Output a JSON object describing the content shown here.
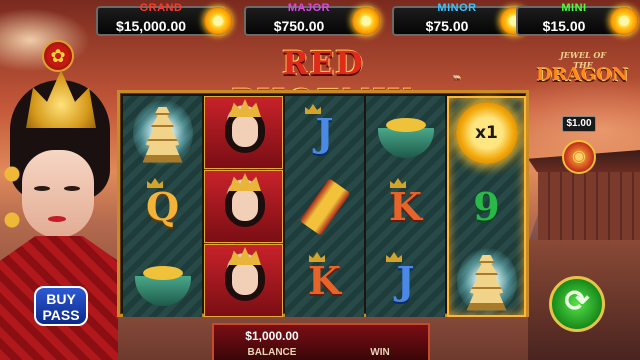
{
  "jackpots": [
    {
      "label": "GRAND",
      "value": "$15,000.00",
      "label_color": "#ff3a2a"
    },
    {
      "label": "MAJOR",
      "value": "$750.00",
      "label_color": "#d94ae0"
    },
    {
      "label": "MINOR",
      "value": "$75.00",
      "label_color": "#3ac4ff"
    },
    {
      "label": "MINI",
      "value": "$15.00",
      "label_color": "#4aff3a"
    }
  ],
  "title": {
    "text": "RED PHOENIX",
    "trademark": "™"
  },
  "side_logo": {
    "top": "JEWEL OF THE",
    "main": "DRAGON"
  },
  "buy_pass": {
    "line1": "BUY",
    "line2": "PASS"
  },
  "reels": [
    [
      "pagoda",
      "Q",
      "bowl"
    ],
    [
      "empress",
      "empress",
      "empress"
    ],
    [
      "J",
      "scroll",
      "K"
    ],
    [
      "bowl",
      "K",
      "J"
    ],
    [
      "multiplier",
      "9",
      "pagoda"
    ]
  ],
  "multiplier_text": "x1",
  "bet": {
    "value": "$1.00"
  },
  "status": {
    "balance_value": "$1,000.00",
    "balance_label": "BALANCE",
    "win_label": "WIN"
  },
  "icons": {
    "settings": "gear-icon",
    "spin": "spin-arrows-icon",
    "bet": "coin-stack-icon"
  }
}
